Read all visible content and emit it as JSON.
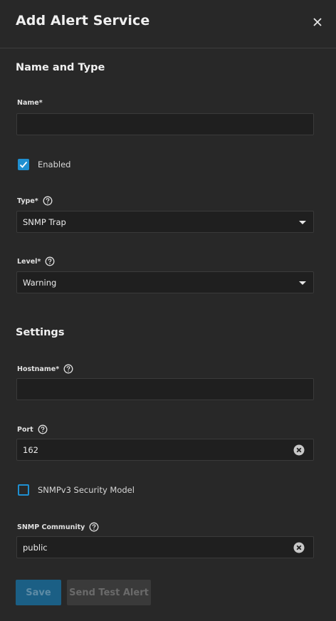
{
  "header": {
    "title": "Add Alert Service"
  },
  "sections": {
    "name_and_type": "Name and Type",
    "settings": "Settings"
  },
  "fields": {
    "name": {
      "label": "Name",
      "required": "*",
      "value": ""
    },
    "enabled": {
      "label": "Enabled",
      "checked": true
    },
    "type": {
      "label": "Type",
      "required": "*",
      "value": "SNMP Trap"
    },
    "level": {
      "label": "Level",
      "required": "*",
      "value": "Warning"
    },
    "hostname": {
      "label": "Hostname",
      "required": "*",
      "value": ""
    },
    "port": {
      "label": "Port",
      "value": "162"
    },
    "snmpv3": {
      "label": "SNMPv3 Security Model",
      "checked": false
    },
    "community": {
      "label": "SNMP Community",
      "value": "public"
    }
  },
  "buttons": {
    "save": "Save",
    "send_test": "Send Test Alert"
  },
  "icons": {
    "close": "close-icon",
    "help": "help-circle-icon",
    "clear": "clear-circle-icon",
    "dropdown": "chevron-down-icon",
    "check": "checkmark-icon"
  },
  "colors": {
    "background": "#282828",
    "field": "#1f1f1f",
    "accent": "#1f8fd0",
    "save_disabled": "#1b5f85",
    "secondary_disabled": "#3a3a3a"
  }
}
